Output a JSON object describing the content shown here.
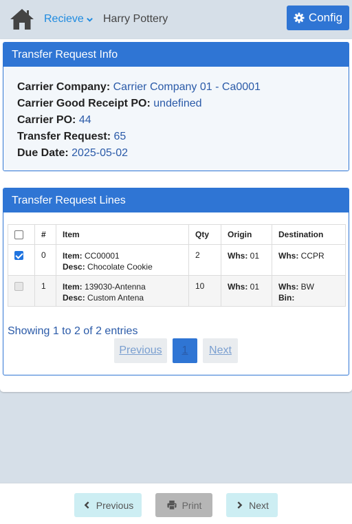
{
  "header": {
    "menu_label": "Recieve",
    "user_name": "Harry Pottery",
    "config_label": "Config"
  },
  "info_card": {
    "title": "Transfer Request Info",
    "rows": [
      {
        "label": "Carrier Company:",
        "value": "Carrier Company 01 - Ca0001"
      },
      {
        "label": "Carrier Good Receipt PO:",
        "value": "undefined"
      },
      {
        "label": "Carrier PO:",
        "value": "44"
      },
      {
        "label": "Transfer Request:",
        "value": "65"
      },
      {
        "label": "Due Date:",
        "value": "2025-05-02"
      }
    ]
  },
  "lines_card": {
    "title": "Transfer Request Lines",
    "columns": [
      "#",
      "Item",
      "Qty",
      "Origin",
      "Destination"
    ],
    "rows": [
      {
        "checked": true,
        "disabled": false,
        "num": "0",
        "item_label": "Item:",
        "item": "CC00001",
        "desc_label": "Desc:",
        "desc": "Chocolate Cookie",
        "qty": "2",
        "whs_label": "Whs:",
        "origin_whs": "01",
        "dest_whs": "CCPR",
        "bin_label": ""
      },
      {
        "checked": false,
        "disabled": true,
        "num": "1",
        "item_label": "Item:",
        "item": "139030-Antenna",
        "desc_label": "Desc:",
        "desc": "Custom Antena",
        "qty": "10",
        "whs_label": "Whs:",
        "origin_whs": "01",
        "dest_whs": "BW",
        "bin_label": "Bin:"
      }
    ],
    "entries_text": "Showing 1 to 2 of 2 entries",
    "pagination": {
      "previous": "Previous",
      "current": "1",
      "next": "Next"
    }
  },
  "bottom_bar": {
    "previous_label": "Previous",
    "print_label": "Print",
    "next_label": "Next"
  },
  "colors": {
    "primary": "#2f75d4",
    "link": "#1f8be0",
    "info_value": "#2a5aa8",
    "nav_button": "#cdeef3",
    "disabled_button": "#b6b6b6"
  }
}
